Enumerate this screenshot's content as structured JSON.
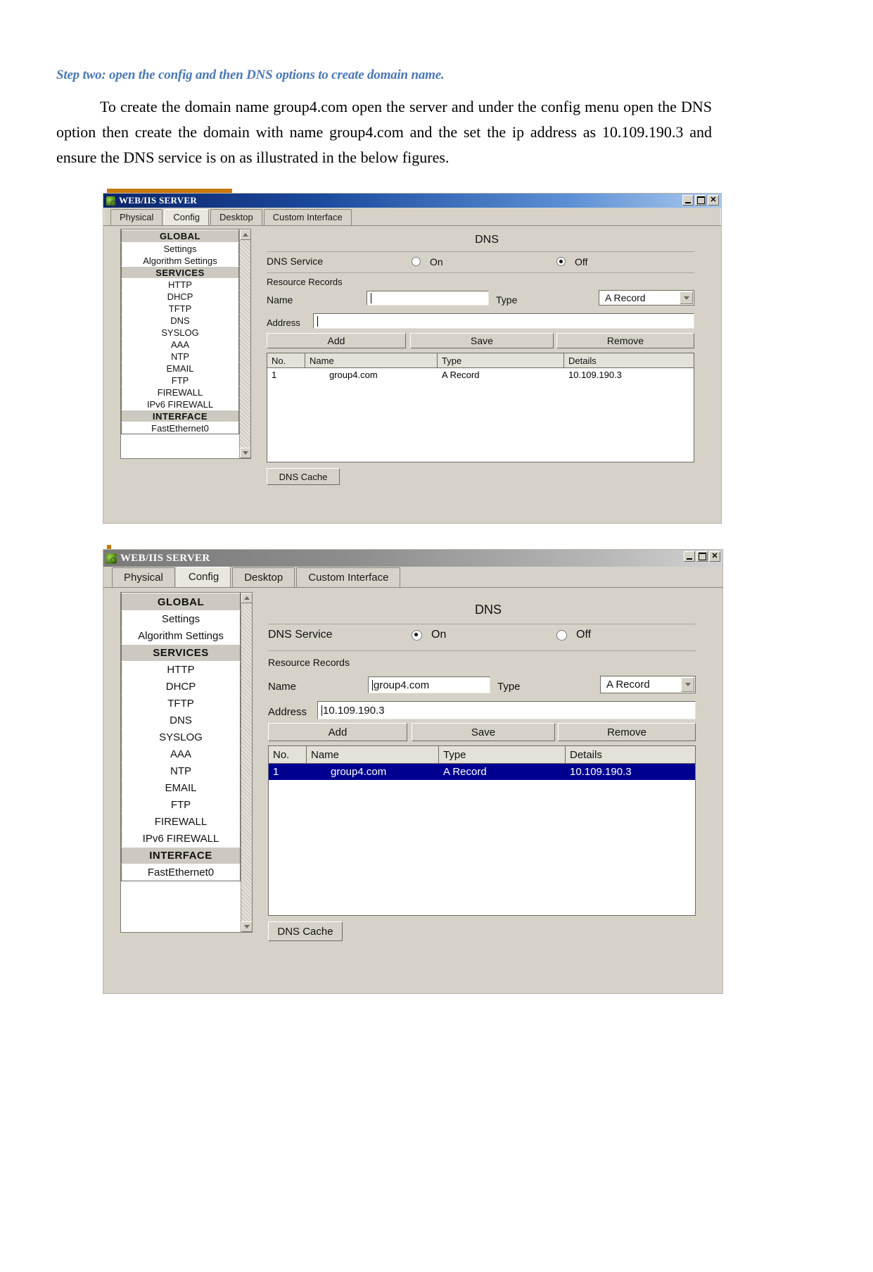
{
  "document": {
    "step_heading": "Step two: open the config and then DNS options to create domain name.",
    "paragraph_line1": "To create the domain name group4.com open the server and under the config menu open the DNS",
    "paragraph_line2": "option then create the domain with name group4.com and the set the ip address as 10.109.190.3 and ensure",
    "paragraph_line3": "the DNS service is on as illustrated in the below figures.",
    "heading_color": "#4a78b5"
  },
  "window": {
    "title": "WEB/IIS SERVER",
    "icon": "packet-tracer-server-icon",
    "controls": {
      "minimize": "_",
      "maximize": "□",
      "close": "×"
    },
    "tabs": [
      {
        "label": "Physical",
        "active": false
      },
      {
        "label": "Config",
        "active": true
      },
      {
        "label": "Desktop",
        "active": false
      },
      {
        "label": "Custom Interface",
        "active": false
      }
    ],
    "sidebar": [
      {
        "label": "GLOBAL",
        "header": true
      },
      {
        "label": "Settings",
        "header": false
      },
      {
        "label": "Algorithm Settings",
        "header": false
      },
      {
        "label": "SERVICES",
        "header": true
      },
      {
        "label": "HTTP",
        "header": false
      },
      {
        "label": "DHCP",
        "header": false
      },
      {
        "label": "TFTP",
        "header": false
      },
      {
        "label": "DNS",
        "header": false
      },
      {
        "label": "SYSLOG",
        "header": false
      },
      {
        "label": "AAA",
        "header": false
      },
      {
        "label": "NTP",
        "header": false
      },
      {
        "label": "EMAIL",
        "header": false
      },
      {
        "label": "FTP",
        "header": false
      },
      {
        "label": "FIREWALL",
        "header": false
      },
      {
        "label": "IPv6 FIREWALL",
        "header": false
      },
      {
        "label": "INTERFACE",
        "header": true
      },
      {
        "label": "FastEthernet0",
        "header": false
      }
    ],
    "panel": {
      "title": "DNS",
      "service_label": "DNS Service",
      "on_label": "On",
      "off_label": "Off",
      "resource_records_label": "Resource Records",
      "name_label": "Name",
      "type_label": "Type",
      "address_label": "Address",
      "buttons": {
        "add": "Add",
        "save": "Save",
        "remove": "Remove",
        "dns_cache": "DNS Cache"
      },
      "table_headers": [
        "No.",
        "Name",
        "Type",
        "Details"
      ]
    }
  },
  "figure_top": {
    "dns_service_state": "Off",
    "name_value": "",
    "type_value": "A Record",
    "address_value": "",
    "row": {
      "no": "1",
      "name": "group4.com",
      "type": "A Record",
      "details": "10.109.190.3"
    },
    "row_selected": false
  },
  "figure_bottom": {
    "dns_service_state": "On",
    "name_value": "group4.com",
    "type_value": "A Record",
    "address_value": "10.109.190.3",
    "row": {
      "no": "1",
      "name": "group4.com",
      "type": "A Record",
      "details": "10.109.190.3"
    },
    "row_selected": true
  }
}
